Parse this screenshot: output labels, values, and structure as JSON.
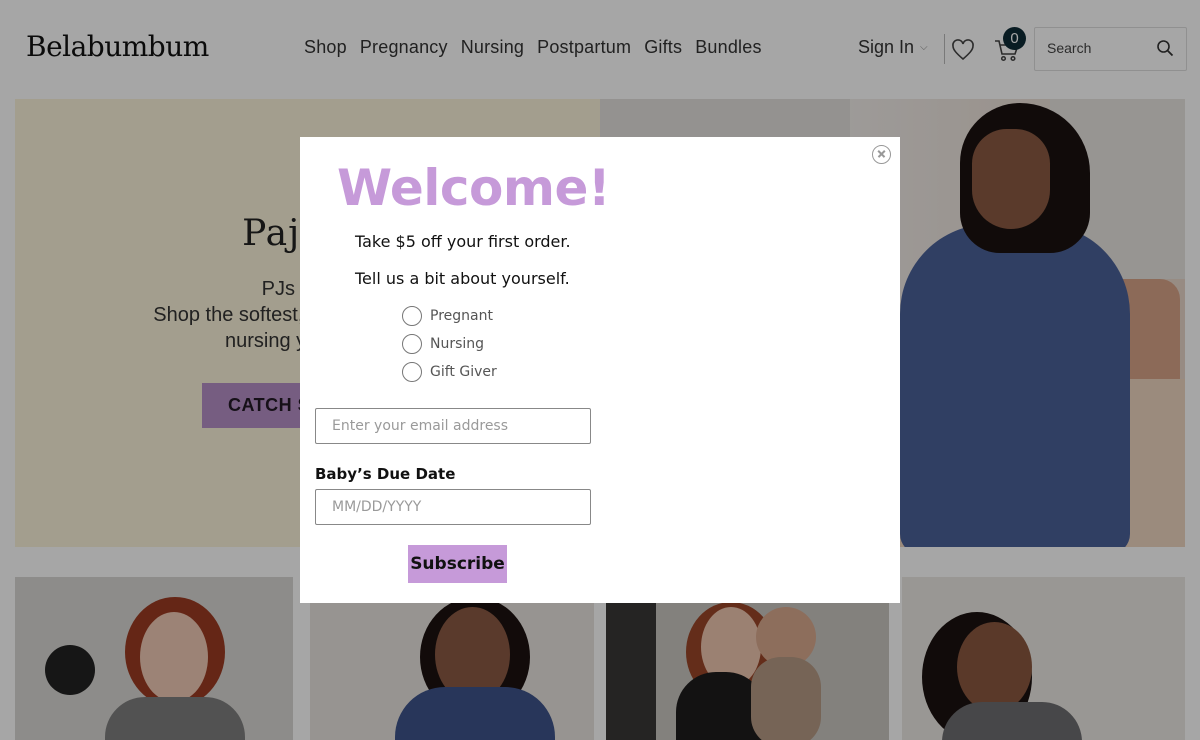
{
  "header": {
    "logo": "Belabumbum",
    "nav": [
      "Shop",
      "Pregnancy",
      "Nursing",
      "Postpartum",
      "Gifts",
      "Bundles"
    ],
    "sign_in": "Sign In",
    "cart_count": "0",
    "search_placeholder": "Search",
    "icons": {
      "wishlist": "heart-icon",
      "cart": "cart-icon",
      "search": "search-icon",
      "dropdown": "chevron-down-icon"
    }
  },
  "hero": {
    "title": "Pajam",
    "subtitle_line1": "PJs all day",
    "subtitle_line2": "Shop the softest, com",
    "subtitle_line3": "nursing your",
    "button": "CATCH S"
  },
  "modal": {
    "heading": "Welcome!",
    "offer": "Take $5 off your first order.",
    "prompt": "Tell us a bit about yourself.",
    "options": [
      "Pregnant",
      "Nursing",
      "Gift Giver"
    ],
    "email_placeholder": "Enter your email address",
    "due_date_label": "Baby’s Due Date",
    "due_date_placeholder": "MM/DD/YYYY",
    "submit": "Subscribe",
    "close_icon": "close-icon"
  },
  "colors": {
    "accent": "#c69ad9",
    "hero_button": "#b690c6",
    "cart_badge": "#0f2c36",
    "hero_bg": "#fbf3da"
  }
}
